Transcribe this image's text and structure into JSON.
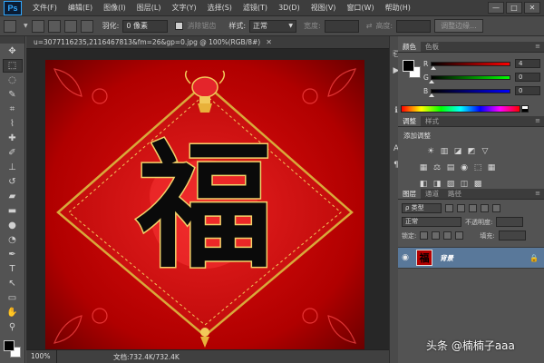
{
  "app": {
    "logo": "Ps"
  },
  "menu": [
    "文件(F)",
    "编辑(E)",
    "图像(I)",
    "图层(L)",
    "文字(Y)",
    "选择(S)",
    "滤镜(T)",
    "3D(D)",
    "视图(V)",
    "窗口(W)",
    "帮助(H)"
  ],
  "window_controls": {
    "minimize": "—",
    "maximize": "□",
    "close": "✕"
  },
  "options": {
    "feather_label": "羽化:",
    "feather_value": "0 像素",
    "antialias_label": "消除锯齿",
    "style_label": "样式:",
    "style_value": "正常",
    "width_label": "宽度:",
    "height_label": "高度:",
    "refine_button": "调整边缘..."
  },
  "document": {
    "tab_title": "u=3077116235,2116467813&fm=26&gp=0.jpg @ 100%(RGB/8#)",
    "close": "✕",
    "character": "福",
    "zoom": "100%",
    "doc_size": "文档:732.4K/732.4K"
  },
  "color_panel": {
    "tabs": [
      "颜色",
      "色板"
    ],
    "channels": [
      {
        "label": "R",
        "value": "4",
        "level": 0.02
      },
      {
        "label": "G",
        "value": "0",
        "level": 0.0
      },
      {
        "label": "B",
        "value": "0",
        "level": 0.0
      }
    ]
  },
  "adjustments_panel": {
    "tabs": [
      "调整",
      "样式"
    ],
    "title": "添加调整",
    "row1": [
      "☀",
      "▥",
      "◪",
      "◩",
      "▽"
    ],
    "row2": [
      "▦",
      "⚖",
      "▤",
      "◉",
      "⬚",
      "▦"
    ],
    "row3": [
      "◧",
      "◨",
      "▨",
      "◫",
      "▩"
    ]
  },
  "layers_panel": {
    "tabs": [
      "图层",
      "通道",
      "路径"
    ],
    "filter_value": "ρ 类型",
    "blend_value": "正常",
    "opacity_label": "不透明度:",
    "lock_label": "锁定:",
    "fill_label": "填充:",
    "layer_name": "背景",
    "thumb_char": "福"
  },
  "watermark": "头条 @楠楠子aaa",
  "colors": {
    "accent": "#31a8ff",
    "canvas_bg": "#a40000",
    "gold": "#d8a93a",
    "layer_selected": "#59789a"
  }
}
